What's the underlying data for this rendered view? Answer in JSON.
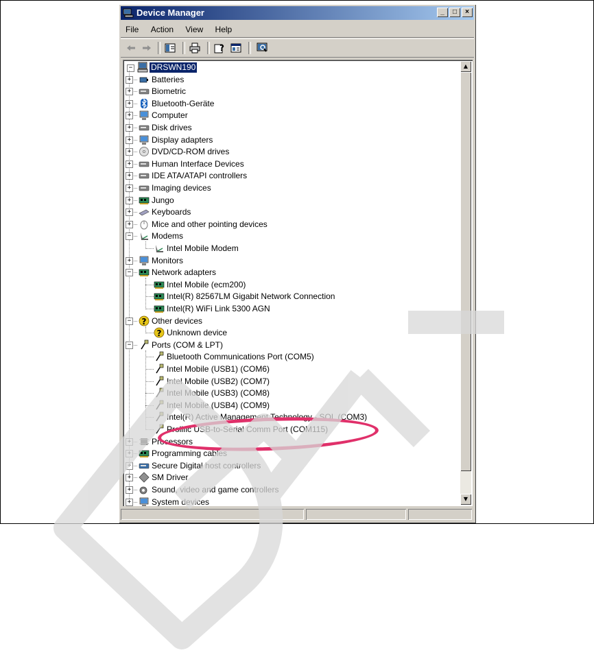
{
  "window": {
    "title": "Device Manager",
    "controls": [
      "_",
      "□",
      "×"
    ]
  },
  "menu": [
    "File",
    "Action",
    "View",
    "Help"
  ],
  "toolbar_icons": [
    "back-arrow-icon",
    "forward-arrow-icon",
    "show-hide-tree-icon",
    "print-icon",
    "properties-help-icon",
    "properties-icon",
    "scan-hardware-icon"
  ],
  "tree": {
    "root": "DRSWN190",
    "items": [
      {
        "label": "Batteries",
        "level": 1,
        "expander": "+",
        "icon": "battery-icon",
        "color": "#3a6ea5"
      },
      {
        "label": "Biometric",
        "level": 1,
        "expander": "+",
        "icon": "biometric-icon",
        "color": "#808080"
      },
      {
        "label": "Bluetooth-Geräte",
        "level": 1,
        "expander": "+",
        "icon": "bluetooth-icon",
        "color": "#1560bd"
      },
      {
        "label": "Computer",
        "level": 1,
        "expander": "+",
        "icon": "computer-icon",
        "color": "#4a90d9"
      },
      {
        "label": "Disk drives",
        "level": 1,
        "expander": "+",
        "icon": "disk-drive-icon",
        "color": "#808080"
      },
      {
        "label": "Display adapters",
        "level": 1,
        "expander": "+",
        "icon": "display-adapter-icon",
        "color": "#4a90d9"
      },
      {
        "label": "DVD/CD-ROM drives",
        "level": 1,
        "expander": "+",
        "icon": "dvd-icon",
        "color": "#a0a0a0"
      },
      {
        "label": "Human Interface Devices",
        "level": 1,
        "expander": "+",
        "icon": "hid-icon",
        "color": "#808080"
      },
      {
        "label": "IDE ATA/ATAPI controllers",
        "level": 1,
        "expander": "+",
        "icon": "ide-controller-icon",
        "color": "#808080"
      },
      {
        "label": "Imaging devices",
        "level": 1,
        "expander": "+",
        "icon": "imaging-icon",
        "color": "#808080"
      },
      {
        "label": "Jungo",
        "level": 1,
        "expander": "+",
        "icon": "board-icon",
        "color": "#2e8b57"
      },
      {
        "label": "Keyboards",
        "level": 1,
        "expander": "+",
        "icon": "keyboard-icon",
        "color": "#a0a0c0"
      },
      {
        "label": "Mice and other pointing devices",
        "level": 1,
        "expander": "+",
        "icon": "mouse-icon",
        "color": "#c0c0c0"
      },
      {
        "label": "Modems",
        "level": 1,
        "expander": "−",
        "icon": "modem-icon",
        "color": "#606060"
      },
      {
        "label": "Intel Mobile Modem",
        "level": 2,
        "icon": "modem-icon",
        "color": "#606060"
      },
      {
        "label": "Monitors",
        "level": 1,
        "expander": "+",
        "icon": "monitor-icon",
        "color": "#4a90d9"
      },
      {
        "label": "Network adapters",
        "level": 1,
        "expander": "−",
        "icon": "network-card-icon",
        "color": "#2e8b57"
      },
      {
        "label": "Intel Mobile (ecm200)",
        "level": 2,
        "icon": "network-card-icon",
        "color": "#2e8b57"
      },
      {
        "label": "Intel(R) 82567LM Gigabit Network Connection",
        "level": 2,
        "icon": "network-card-icon",
        "color": "#2e8b57"
      },
      {
        "label": "Intel(R) WiFi Link 5300 AGN",
        "level": 2,
        "icon": "network-card-icon",
        "color": "#2e8b57"
      },
      {
        "label": "Other devices",
        "level": 1,
        "expander": "−",
        "icon": "unknown-device-icon",
        "color": "#e6c619"
      },
      {
        "label": "Unknown device",
        "level": 2,
        "icon": "unknown-device-icon",
        "color": "#e6c619"
      },
      {
        "label": "Ports (COM & LPT)",
        "level": 1,
        "expander": "−",
        "icon": "port-icon",
        "color": "#b8b870"
      },
      {
        "label": "Bluetooth Communications Port (COM5)",
        "level": 2,
        "icon": "port-icon",
        "color": "#b8b870"
      },
      {
        "label": "Intel Mobile (USB1) (COM6)",
        "level": 2,
        "icon": "port-icon",
        "color": "#b8b870"
      },
      {
        "label": "Intel Mobile (USB2) (COM7)",
        "level": 2,
        "icon": "port-icon",
        "color": "#b8b870"
      },
      {
        "label": "Intel Mobile (USB3) (COM8)",
        "level": 2,
        "icon": "port-icon",
        "color": "#b8b870"
      },
      {
        "label": "Intel Mobile (USB4) (COM9)",
        "level": 2,
        "icon": "port-icon",
        "color": "#b8b870"
      },
      {
        "label": "Intel(R) Active Management Technology - SOL (COM3)",
        "level": 2,
        "icon": "port-icon",
        "color": "#b8b870"
      },
      {
        "label": "Prolific USB-to-Serial Comm Port (COM115)",
        "level": 2,
        "icon": "port-icon",
        "color": "#b8b870"
      },
      {
        "label": "Processors",
        "level": 1,
        "expander": "+",
        "icon": "processor-icon",
        "color": "#404040"
      },
      {
        "label": "Programming cables",
        "level": 1,
        "expander": "+",
        "icon": "board-icon",
        "color": "#2e8b57"
      },
      {
        "label": "Secure Digital host controllers",
        "level": 1,
        "expander": "+",
        "icon": "sd-controller-icon",
        "color": "#3a6ea5"
      },
      {
        "label": "SM Driver",
        "level": 1,
        "expander": "+",
        "icon": "driver-icon",
        "color": "#909090"
      },
      {
        "label": "Sound, video and game controllers",
        "level": 1,
        "expander": "+",
        "icon": "sound-icon",
        "color": "#808080"
      },
      {
        "label": "System devices",
        "level": 1,
        "expander": "+",
        "icon": "system-device-icon",
        "color": "#4a90d9"
      }
    ]
  },
  "highlight": {
    "target": "Prolific USB-to-Serial Comm Port (COM115)",
    "color": "#e0306a"
  },
  "watermark": {
    "text": "Draft",
    "color": "#d8d8d8"
  },
  "colors": {
    "title_start": "#0a246a",
    "title_end": "#a6caf0",
    "selection": "#0a246a",
    "chrome": "#d4d0c8"
  }
}
